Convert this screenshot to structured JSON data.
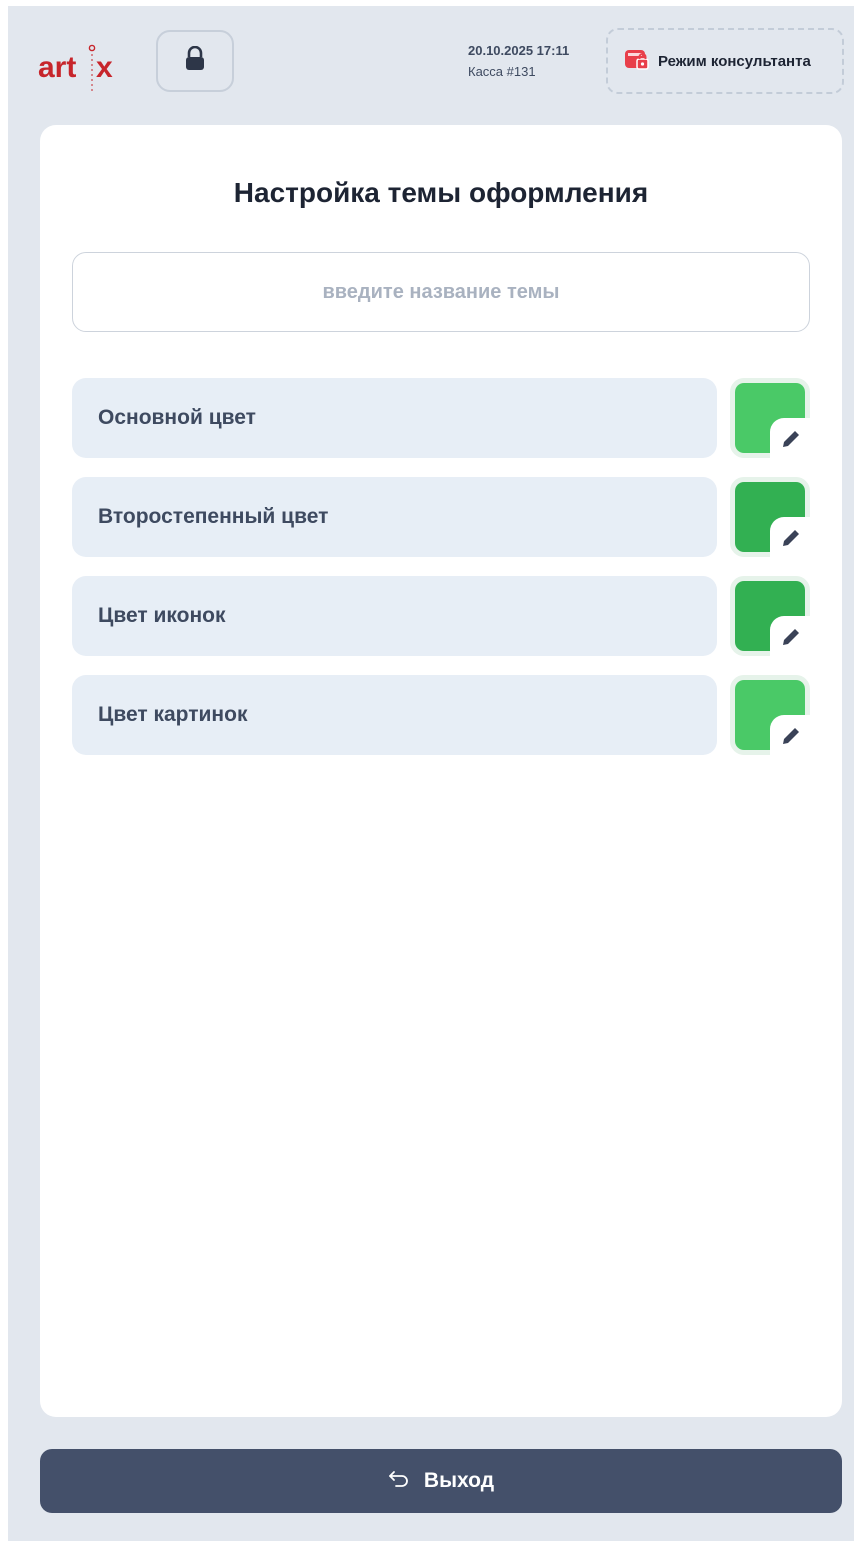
{
  "header": {
    "logo_text": "art x",
    "datetime": "20.10.2025 17:11",
    "register": "Касса #131",
    "consultant_button": "Режим консультанта"
  },
  "page": {
    "title": "Настройка темы оформления",
    "theme_name_placeholder": "введите название темы",
    "theme_name_value": ""
  },
  "colors": {
    "items": [
      {
        "label": "Основной цвет",
        "color": "#4ac967"
      },
      {
        "label": "Второстепенный цвет",
        "color": "#32b052"
      },
      {
        "label": "Цвет иконок",
        "color": "#32b052"
      },
      {
        "label": "Цвет картинок",
        "color": "#4ac967"
      }
    ]
  },
  "icons": {
    "lock": "lock-icon",
    "consultant": "store-lock-icon",
    "edit": "pencil-icon",
    "exit": "undo-arrow-icon"
  },
  "footer": {
    "exit_button": "Выход"
  },
  "theme": {
    "brand_red": "#c7252b",
    "dark_button": "#44506a",
    "background": "#e2e7ee"
  }
}
